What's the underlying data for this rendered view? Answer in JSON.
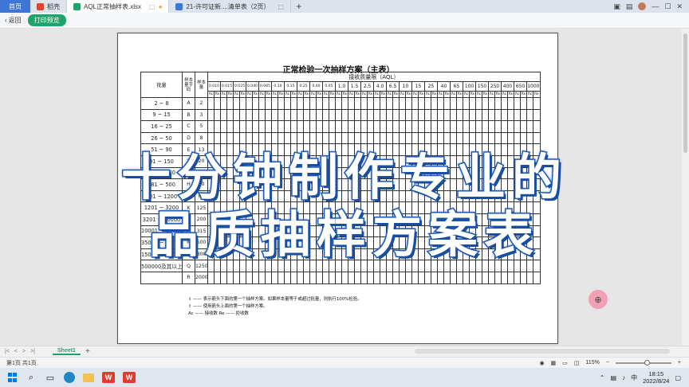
{
  "tabs": {
    "home": "首页",
    "items": [
      {
        "label": "稻壳",
        "icon": "daoke-icon"
      },
      {
        "label": "AQL正常抽样表.xlsx",
        "active": true
      },
      {
        "label": "21-许可证新....清单表（2页）"
      }
    ],
    "add": "+"
  },
  "toolbar": {
    "back_label": "返回",
    "print_preview_label": "打印预览"
  },
  "sheet": {
    "title": "正常检验一次抽样方案（主表）",
    "aql_header": "接收质量限（AQL）",
    "col_lot": "批量",
    "col_code": "样本量字码",
    "col_size": "样本量",
    "aql_levels": [
      "0.010",
      "0.015",
      "0.025",
      "0.040",
      "0.065",
      "0.10",
      "0.15",
      "0.25",
      "0.40",
      "0.65",
      "1.0",
      "1.5",
      "2.5",
      "4.0",
      "6.5",
      "10",
      "15",
      "25",
      "40",
      "65",
      "100",
      "150",
      "250",
      "400",
      "650",
      "1000"
    ],
    "ac": "Ac",
    "re": "Re",
    "rows": [
      {
        "lot": "2 ~ 8",
        "code": "A",
        "size": "2"
      },
      {
        "lot": "9 ~ 15",
        "code": "B",
        "size": "3"
      },
      {
        "lot": "16 ~ 25",
        "code": "C",
        "size": "5"
      },
      {
        "lot": "26 ~ 50",
        "code": "D",
        "size": "8"
      },
      {
        "lot": "51 ~ 90",
        "code": "E",
        "size": "13"
      },
      {
        "lot": "91 ~ 150",
        "code": "F",
        "size": "20"
      },
      {
        "lot": "151 ~ 280",
        "code": "G",
        "size": "32"
      },
      {
        "lot": "281 ~ 500",
        "code": "H",
        "size": "50"
      },
      {
        "lot": "501 ~ 1200",
        "code": "J",
        "size": "80"
      },
      {
        "lot": "1201 ~ 3200",
        "code": "K",
        "size": "125"
      },
      {
        "lot": "3201 ~ 10000",
        "code": "L",
        "size": "200"
      },
      {
        "lot": "10001 ~ 35000",
        "code": "M",
        "size": "315"
      },
      {
        "lot": "35001 ~ 150000",
        "code": "N",
        "size": "500"
      },
      {
        "lot": "150001 ~ 500000",
        "code": "P",
        "size": "800"
      },
      {
        "lot": "500000及其以上",
        "code": "Q",
        "size": "1250"
      },
      {
        "lot": "",
        "code": "R",
        "size": "2000"
      }
    ],
    "notes": [
      "⇩ —— 表示箭头下面的第一个抽样方案。如果样本量等于或超过批量，则执行100%检验。",
      "⇧ —— 使用箭头上面的第一个抽样方案。",
      "Ac —— 接收数          Re —— 拒收数"
    ]
  },
  "overlay": {
    "line1": "十分钟制作专业的",
    "line2": "品质抽样方案表"
  },
  "sheetbar": {
    "sheet_name": "Sheet1"
  },
  "status": {
    "page_info": "第1页 共1页",
    "zoom": "115%"
  },
  "taskbar": {
    "time": "18:15",
    "date": "2022/8/24"
  },
  "colors": {
    "brand_green": "#1fa36b",
    "home_tab": "#3d76d6",
    "banner_stroke": "#1f5fc4"
  }
}
